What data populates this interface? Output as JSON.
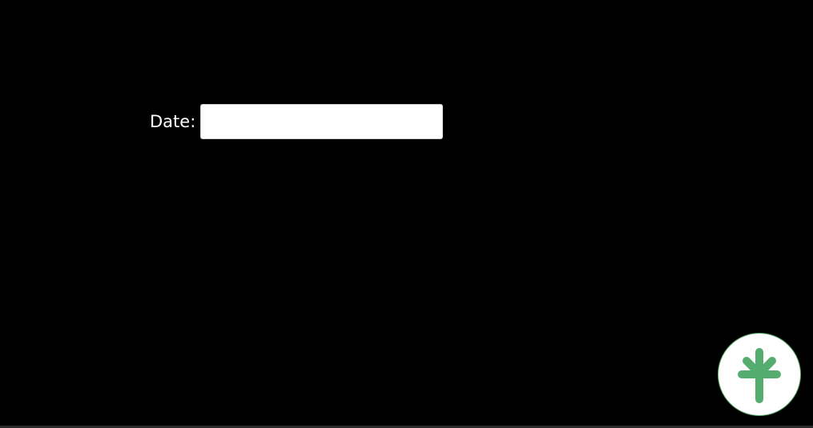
{
  "form": {
    "date_label": "Date:",
    "date_value": "",
    "date_placeholder": ""
  },
  "fab": {
    "icon": "sprout-icon",
    "color": "#54ad6e"
  },
  "colors": {
    "background": "#000000",
    "label": "#ffffff",
    "input_bg": "#ffffff"
  }
}
